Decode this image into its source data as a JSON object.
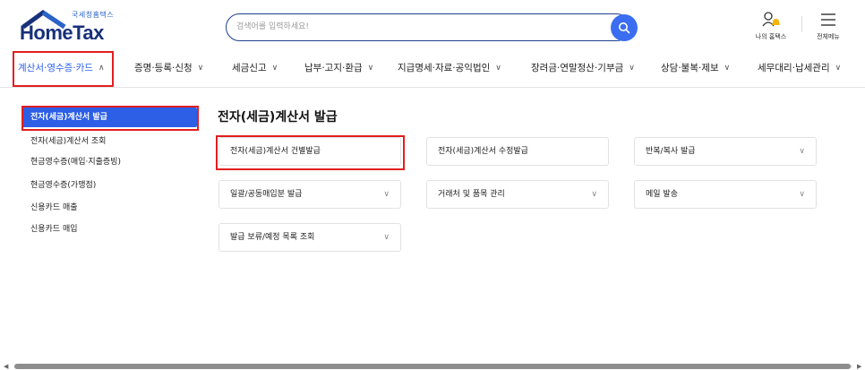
{
  "header": {
    "logo_sub": "국세청홈택스",
    "logo_main": "HomeTax",
    "search_placeholder": "검색어를 입력하세요!",
    "my_hometax_label": "나의 홈택스",
    "all_menu_label": "전체메뉴"
  },
  "nav": {
    "items": [
      {
        "label": "계산서·영수증·카드",
        "chev": "∧"
      },
      {
        "label": "증명·등록·신청",
        "chev": "∨"
      },
      {
        "label": "세금신고",
        "chev": "∨"
      },
      {
        "label": "납부·고지·환급",
        "chev": "∨"
      },
      {
        "label": "지급명세·자료·공익법인",
        "chev": "∨"
      },
      {
        "label": "장려금·연말정산·기부금",
        "chev": "∨"
      },
      {
        "label": "상담·불복·제보",
        "chev": "∨"
      },
      {
        "label": "세무대리·납세관리",
        "chev": "∨"
      }
    ]
  },
  "sidebar": {
    "items": [
      {
        "label": "전자(세금)계산서 발급"
      },
      {
        "label": "전자(세금)계산서 조회"
      },
      {
        "label": "현금영수증(매입·지출증빙)"
      },
      {
        "label": "현금영수증(가맹점)"
      },
      {
        "label": "신용카드 매출"
      },
      {
        "label": "신용카드 매입"
      }
    ]
  },
  "main": {
    "title": "전자(세금)계산서 발급",
    "cards": [
      {
        "label": "전자(세금)계산서 건별발급",
        "chev": ""
      },
      {
        "label": "전자(세금)계산서 수정발급",
        "chev": ""
      },
      {
        "label": "반복/복사 발급",
        "chev": "∨"
      },
      {
        "label": "일괄/공동매입분 발급",
        "chev": "∨"
      },
      {
        "label": "거래처 및 품목 관리",
        "chev": "∨"
      },
      {
        "label": "메일 발송",
        "chev": "∨"
      },
      {
        "label": "발급 보류/예정 목록 조회",
        "chev": "∨"
      }
    ]
  },
  "scrollbar": {
    "left_arrow": "◀",
    "right_arrow": "▶"
  },
  "colors": {
    "brand": "#17307a",
    "accent": "#2c5fe6",
    "highlight": "#e21f1f"
  }
}
